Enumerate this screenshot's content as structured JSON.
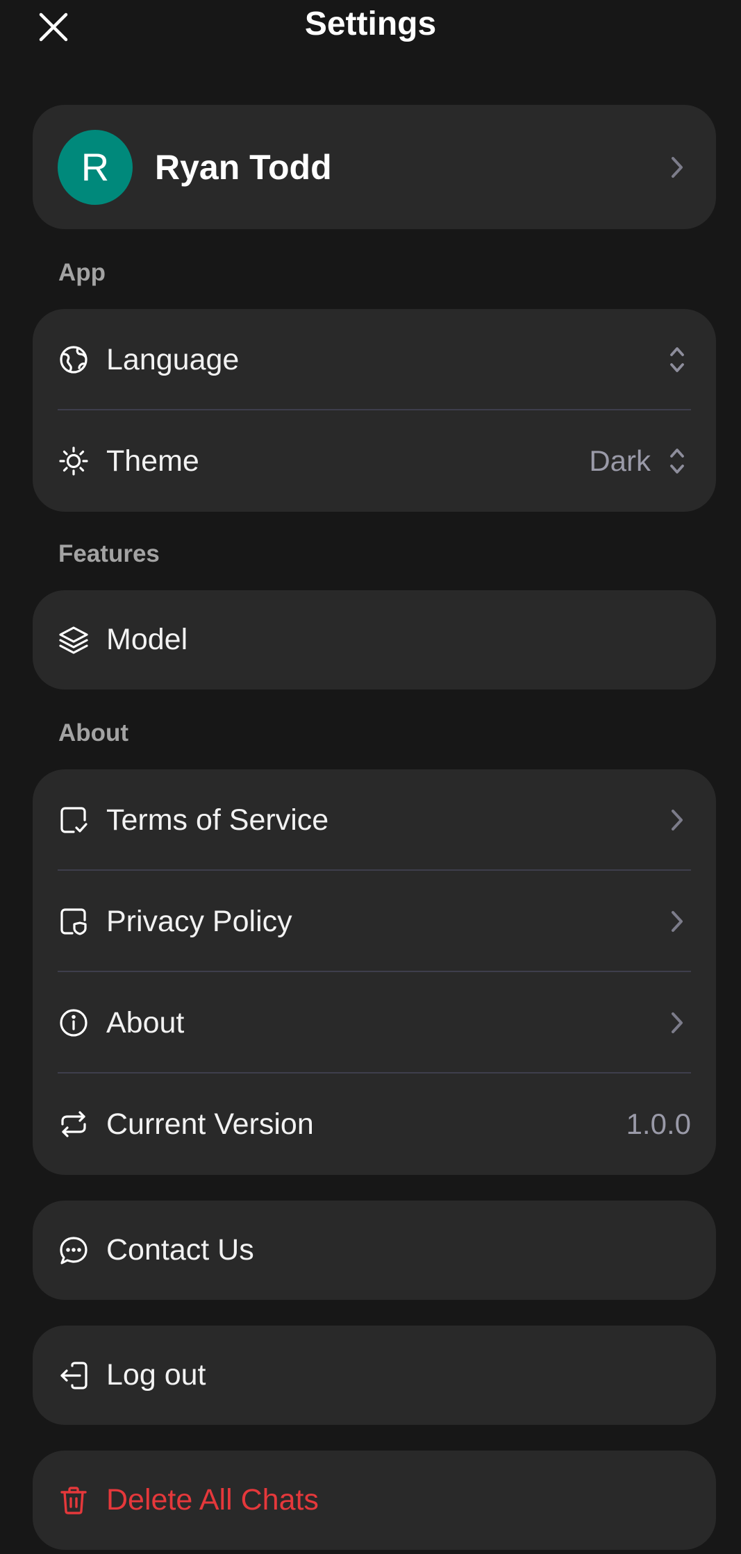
{
  "header": {
    "title": "Settings",
    "close_icon": "close-icon"
  },
  "profile": {
    "avatar_initial": "R",
    "name": "Ryan Todd",
    "avatar_color": "#00897b"
  },
  "sections": {
    "app": {
      "label": "App",
      "language_label": "Language",
      "theme_label": "Theme",
      "theme_value": "Dark"
    },
    "features": {
      "label": "Features",
      "model_label": "Model"
    },
    "about": {
      "label": "About",
      "terms_label": "Terms of Service",
      "privacy_label": "Privacy Policy",
      "about_label": "About",
      "version_label": "Current Version",
      "version_value": "1.0.0"
    }
  },
  "actions": {
    "contact_label": "Contact Us",
    "logout_label": "Log out",
    "delete_label": "Delete All Chats"
  },
  "colors": {
    "background": "#171717",
    "card": "#292929",
    "danger": "#e5383b",
    "muted": "#9a9aa8"
  }
}
